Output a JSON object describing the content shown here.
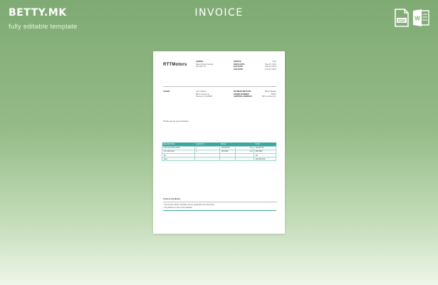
{
  "header": {
    "brand": "BETTY.MK",
    "tagline": "fully editable template",
    "title": "INVOICE",
    "pdf_label": "PDF",
    "word_label": "W"
  },
  "colors": {
    "accent": "#3aa7a0",
    "background_top": "#7faa73",
    "background_bottom": "#eef6ea"
  },
  "icons": [
    "pdf-file-icon",
    "word-file-icon"
  ],
  "invoice": {
    "company": "RTTMotors",
    "seller": [
      "SARRIO",
      "Ranet Street Ventura",
      "222 333 777"
    ],
    "invoice_labels": [
      "INVOICE",
      "ISSUE DATE",
      "DUE DATE",
      "DUE DATE"
    ],
    "invoice_values": [
      "1712",
      "May 25, 2021",
      "May 25, 2021",
      "June 25, 2021"
    ],
    "client_label": "CLIENT",
    "client": [
      "John Ottawa",
      "98 N. Avenue St.",
      "Fremont, CA 94538"
    ],
    "payment_labels": [
      "PAYMENT METHOD",
      "ORDER NUMBER",
      "SHIPPING ADDRESS"
    ],
    "payment_values": [
      "Bank Transfer",
      "#2512",
      "98 N. Avenue St.,"
    ],
    "thanks": "Thank you for your purchase.",
    "columns": [
      "DESCRIPTION",
      "QUANTITY",
      "PRICE",
      "",
      "TOTAL"
    ],
    "rows": [
      [
        "Chevrolet 2010 Model",
        "1",
        "100 007,00",
        "unit",
        "100 007,00"
      ],
      [
        "Tyre (M4-Neo)",
        "4",
        "125 PEM",
        "unit",
        "500 PEM"
      ],
      [
        "Tax",
        "",
        "",
        "",
        "1%"
      ],
      [
        "Total",
        "",
        "",
        "",
        "100 256,58 €"
      ]
    ],
    "terms_title": "Terms & Conditions",
    "terms": [
      "• The invoice above excludes the tax applicable and other fees",
      "• The balance is due at the dispatch"
    ]
  }
}
